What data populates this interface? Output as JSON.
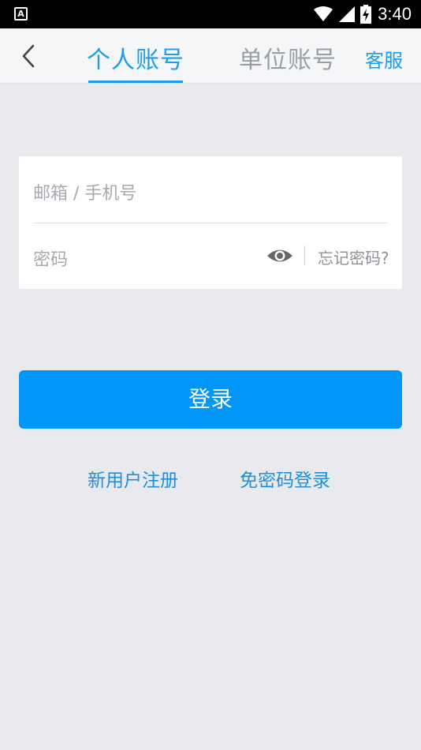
{
  "status_bar": {
    "app_icon_letter": "A",
    "time": "3:40",
    "icons": [
      "wifi-icon",
      "signal-icon",
      "battery-charging-icon"
    ]
  },
  "header": {
    "back_icon": "chevron-left-icon",
    "tabs": [
      {
        "label": "个人账号",
        "active": true
      },
      {
        "label": "单位账号",
        "active": false
      }
    ],
    "service_label": "客服"
  },
  "form": {
    "account_placeholder": "邮箱 / 手机号",
    "password_placeholder": "密码",
    "eye_icon": "eye-icon",
    "forgot_label": "忘记密码?"
  },
  "login_button_label": "登录",
  "links": {
    "register": "新用户注册",
    "passwordless": "免密码登录"
  },
  "colors": {
    "accent": "#1E9DEB",
    "button": "#0396F9",
    "background": "#E8EAEE"
  }
}
